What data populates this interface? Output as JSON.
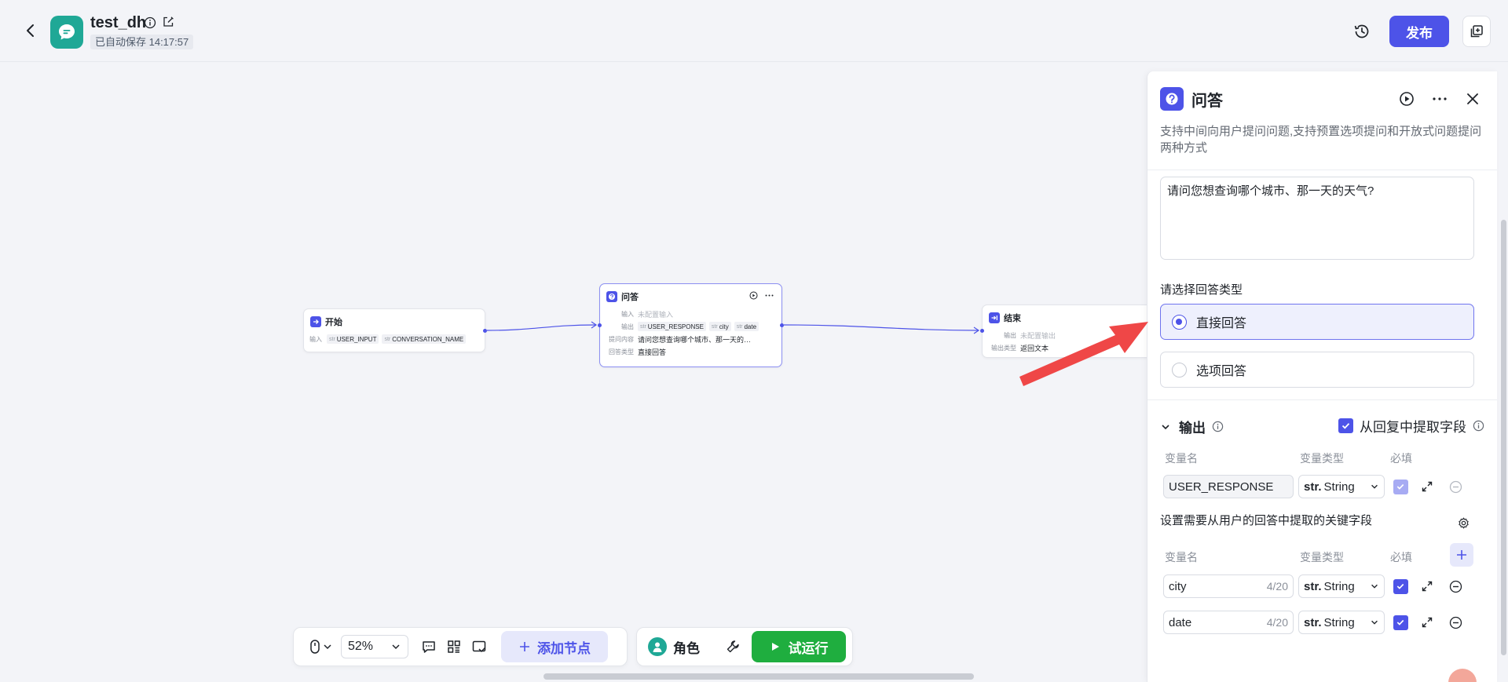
{
  "header": {
    "app_title": "test_dh",
    "autosave": "已自动保存 14:17:57",
    "publish_label": "发布",
    "icons": {
      "back": "chevron-left-icon",
      "info": "info-icon",
      "edit": "edit-icon",
      "history": "history-icon",
      "copy": "copy-icon"
    }
  },
  "nodes": {
    "start": {
      "title": "开始",
      "input_label": "输入",
      "tags": [
        "USER_INPUT",
        "CONVERSATION_NAME"
      ],
      "tag_type": "str"
    },
    "qa": {
      "title": "问答",
      "input_label": "输入",
      "input_value": "未配置输入",
      "output_label": "输出",
      "outputs": [
        "USER_RESPONSE",
        "city",
        "date"
      ],
      "tag_type": "str",
      "question_label": "提问内容",
      "question_value": "请问您想查询哪个城市、那一天的…",
      "answer_type_label": "回答类型",
      "answer_type_value": "直接回答"
    },
    "end": {
      "title": "结束",
      "output_label": "输出",
      "output_value": "未配置输出",
      "output_type_label": "输出类型",
      "output_type_value": "返回文本"
    }
  },
  "toolbar": {
    "zoom": "52%",
    "add_node_label": "添加节点",
    "role_label": "角色",
    "run_label": "试运行"
  },
  "panel": {
    "title": "问答",
    "description": "支持中间向用户提问问题,支持预置选项提问和开放式问题提问两种方式",
    "question": "请问您想查询哪个城市、那一天的天气?",
    "answer_type_label": "请选择回答类型",
    "answer_options": [
      "直接回答",
      "选项回答"
    ],
    "selected_option": "直接回答",
    "output_label": "输出",
    "extract_label": "从回复中提取字段",
    "col_name": "变量名",
    "col_type": "变量类型",
    "col_required": "必填",
    "response_var": {
      "name": "USER_RESPONSE",
      "type_prefix": "str.",
      "type": "String"
    },
    "extract_desc": "设置需要从用户的回答中提取的关键字段",
    "fields": [
      {
        "name": "city",
        "count": "4/20",
        "type_prefix": "str.",
        "type": "String"
      },
      {
        "name": "date",
        "count": "4/20",
        "type_prefix": "str.",
        "type": "String"
      }
    ]
  },
  "colors": {
    "accent": "#4d53e8",
    "run_green": "#1fae3f",
    "app_teal": "#1fa896",
    "annotation_red": "#ef4747"
  }
}
